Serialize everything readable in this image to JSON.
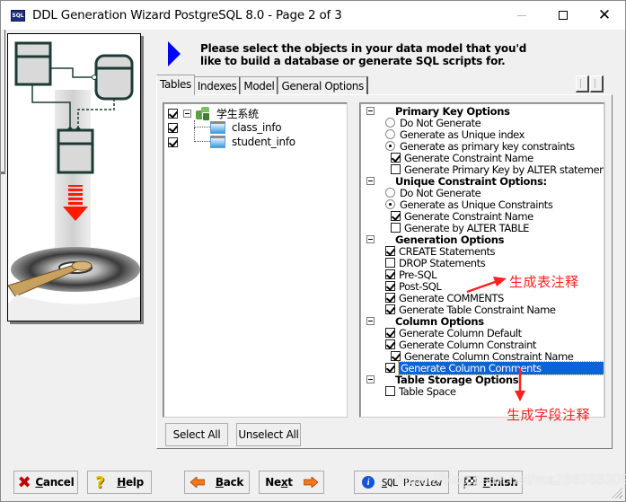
{
  "window": {
    "title": "DDL Generation Wizard PostgreSQL 8.0 - Page 2 of 3",
    "app_icon_text": "SQL",
    "controls": {
      "minimize": "minimize",
      "maximize": "maximize",
      "close": "✕"
    }
  },
  "header": {
    "instruction_line1": "Please select the objects in your data model that you'd",
    "instruction_line2": "like to build a database or generate SQL scripts for."
  },
  "tabs": [
    {
      "label": "Tables",
      "active": true
    },
    {
      "label": "Indexes",
      "active": false
    },
    {
      "label": "Model",
      "active": false
    },
    {
      "label": "General Options",
      "active": false
    }
  ],
  "tree": {
    "root": {
      "label": "学生系统",
      "checked": true,
      "expanded": true
    },
    "children": [
      {
        "label": "class_info",
        "checked": true
      },
      {
        "label": "student_info",
        "checked": true
      }
    ]
  },
  "options": {
    "primary_key": {
      "header": "Primary Key Options",
      "radios": [
        {
          "label": "Do Not Generate",
          "checked": false
        },
        {
          "label": "Generate as Unique index",
          "checked": false
        },
        {
          "label": "Generate as primary key constraints",
          "checked": true
        }
      ],
      "checks": [
        {
          "label": "Generate Constraint Name",
          "checked": true
        },
        {
          "label": "Generate Primary Key by ALTER statement",
          "checked": false
        }
      ]
    },
    "unique_constraint": {
      "header": "Unique Constraint Options:",
      "radios": [
        {
          "label": "Do Not Generate",
          "checked": false
        },
        {
          "label": "Generate as Unique Constraints",
          "checked": true
        }
      ],
      "checks": [
        {
          "label": "Generate Constraint Name",
          "checked": true
        },
        {
          "label": "Generate by ALTER TABLE",
          "checked": false
        }
      ]
    },
    "generation": {
      "header": "Generation Options",
      "checks": [
        {
          "label": "CREATE Statements",
          "checked": true
        },
        {
          "label": "DROP Statements",
          "checked": false
        },
        {
          "label": "Pre-SQL",
          "checked": true
        },
        {
          "label": "Post-SQL",
          "checked": true
        },
        {
          "label": "Generate COMMENTS",
          "checked": true
        },
        {
          "label": "Generate Table Constraint Name",
          "checked": true
        }
      ]
    },
    "column": {
      "header": "Column Options",
      "checks": [
        {
          "label": "Generate Column Default",
          "checked": true
        },
        {
          "label": "Generate Column Constraint",
          "checked": true
        },
        {
          "label": "Generate Column Constraint Name",
          "checked": true
        },
        {
          "label": "Generate Column Comments",
          "checked": true,
          "selected": true
        }
      ]
    },
    "table_storage": {
      "header": "Table Storage Options",
      "checks": [
        {
          "label": "Table Space",
          "checked": false
        }
      ]
    }
  },
  "annotations": {
    "table_comments": "生成表注释",
    "column_comments": "生成字段注释",
    "color": "#ff2020"
  },
  "buttons": {
    "select_all": "Select All",
    "unselect_all": "Unselect All",
    "cancel": {
      "mnemonic": "C",
      "rest": "ancel"
    },
    "help": {
      "mnemonic": "H",
      "rest": "elp"
    },
    "back": {
      "mnemonic": "B",
      "rest": "ack"
    },
    "next": {
      "pre": "Ne",
      "mnemonic": "x",
      "rest": "t"
    },
    "sql_preview": {
      "mnemonic": "S",
      "rest": "QL Preview"
    },
    "finish": {
      "mnemonic": "F",
      "rest": "inish"
    }
  },
  "watermark": "https://blog.csdn.net/ma286388309",
  "colors": {
    "selection": "#0a64d7",
    "instruction_arrow": "#0000ff",
    "nav_arrow": "#f07820"
  }
}
